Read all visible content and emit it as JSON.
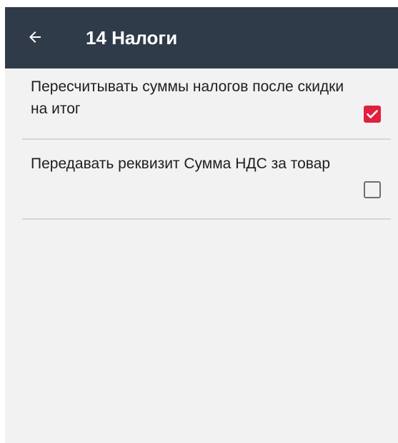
{
  "toolbar": {
    "title": "14 Налоги",
    "back_icon": "arrow-left-icon",
    "background": "#2f3b49"
  },
  "preferences": [
    {
      "label": "Пересчитывать суммы налогов после скидки на итог",
      "checked": true
    },
    {
      "label": "Передавать реквизит Сумма НДС за товар",
      "checked": false
    }
  ],
  "colors": {
    "accent": "#e0213e",
    "background": "#f2f2f2",
    "divider": "#d6d6d6"
  }
}
